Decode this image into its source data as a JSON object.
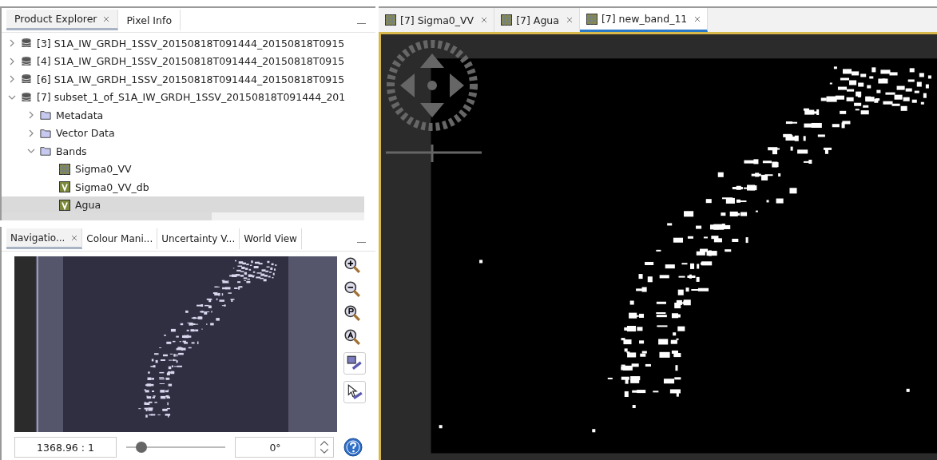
{
  "explorer": {
    "tabs": [
      {
        "label": "Product Explorer",
        "closable": true,
        "selected": true
      },
      {
        "label": "Pixel Info",
        "closable": false,
        "selected": false
      }
    ],
    "tree": [
      {
        "label": "[3] S1A_IW_GRDH_1SSV_20150818T091444_20150818T0915",
        "kind": "product",
        "expanded": false,
        "selected": false
      },
      {
        "label": "[4] S1A_IW_GRDH_1SSV_20150818T091444_20150818T0915",
        "kind": "product",
        "expanded": false,
        "selected": false
      },
      {
        "label": "[6] S1A_IW_GRDH_1SSV_20150818T091444_20150818T0915",
        "kind": "product",
        "expanded": false,
        "selected": false
      },
      {
        "label": "[7] subset_1_of_S1A_IW_GRDH_1SSV_20150818T091444_201",
        "kind": "product",
        "expanded": true,
        "selected": false,
        "children": [
          {
            "label": "Metadata",
            "kind": "folder",
            "expanded": false,
            "selected": false
          },
          {
            "label": "Vector Data",
            "kind": "folder",
            "expanded": false,
            "selected": false
          },
          {
            "label": "Bands",
            "kind": "folder",
            "expanded": true,
            "selected": false,
            "children": [
              {
                "label": "Sigma0_VV",
                "kind": "raster_band",
                "selected": false
              },
              {
                "label": "Sigma0_VV_db",
                "kind": "virtual_band",
                "selected": false
              },
              {
                "label": "Agua",
                "kind": "virtual_band",
                "selected": true
              }
            ]
          }
        ]
      }
    ]
  },
  "navigation": {
    "tabs": [
      {
        "label": "Navigatio...",
        "closable": true,
        "selected": true
      },
      {
        "label": "Colour Mani...",
        "closable": false,
        "selected": false
      },
      {
        "label": "Uncertainty V...",
        "closable": false,
        "selected": false
      },
      {
        "label": "World View",
        "closable": false,
        "selected": false
      }
    ],
    "scale": "1368.96 : 1",
    "zoom": {
      "level": 0.15
    },
    "rotation": "0°"
  },
  "image_tabs": [
    {
      "label": "[7] Sigma0_VV",
      "selected": false
    },
    {
      "label": "[7] Agua",
      "selected": false
    },
    {
      "label": "[7] new_band_11",
      "selected": true
    }
  ]
}
